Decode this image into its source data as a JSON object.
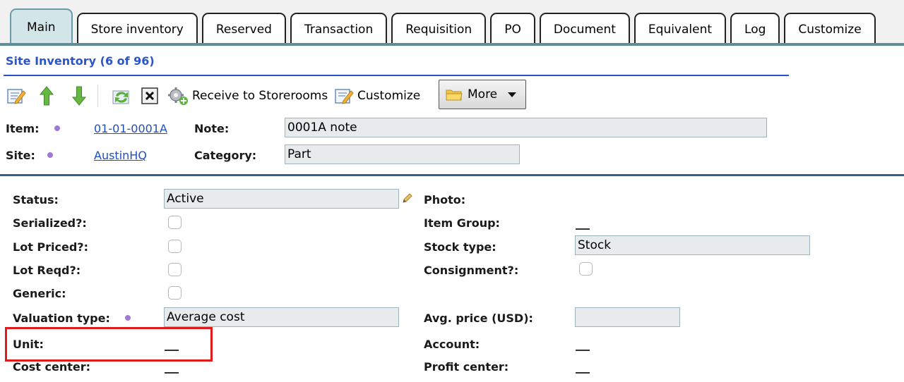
{
  "tabs": [
    {
      "label": "Main",
      "active": true
    },
    {
      "label": "Store inventory"
    },
    {
      "label": "Reserved"
    },
    {
      "label": "Transaction"
    },
    {
      "label": "Requisition"
    },
    {
      "label": "PO"
    },
    {
      "label": "Document"
    },
    {
      "label": "Equivalent"
    },
    {
      "label": "Log"
    },
    {
      "label": "Customize"
    }
  ],
  "section": {
    "title": "Site Inventory (6 of 96)"
  },
  "toolbar": {
    "receive_label": "Receive to Storerooms",
    "customize_label": "Customize",
    "more_label": "More"
  },
  "header": {
    "item_label": "Item:",
    "item_value": "01-01-0001A",
    "note_label": "Note:",
    "note_value": "0001A note",
    "site_label": "Site:",
    "site_value": "AustinHQ",
    "category_label": "Category:",
    "category_value": "Part"
  },
  "details": {
    "status_label": "Status:",
    "status_value": "Active",
    "serialized_label": "Serialized?:",
    "lot_priced_label": "Lot Priced?:",
    "lot_reqd_label": "Lot Reqd?:",
    "generic_label": "Generic:",
    "valuation_type_label": "Valuation type:",
    "valuation_type_value": "Average cost",
    "unit_label": "Unit:",
    "cost_center_label": "Cost center:",
    "photo_label": "Photo:",
    "item_group_label": "Item Group:",
    "stock_type_label": "Stock type:",
    "stock_type_value": "Stock",
    "consignment_label": "Consignment?:",
    "avg_price_label": "Avg. price (USD):",
    "avg_price_value": "",
    "account_label": "Account:",
    "profit_center_label": "Profit center:"
  },
  "colors": {
    "accent_link": "#1d4fc4",
    "tab_active": "#d2e6ea",
    "highlight_box": "#e01b1b",
    "required_dot": "#a078d6"
  }
}
